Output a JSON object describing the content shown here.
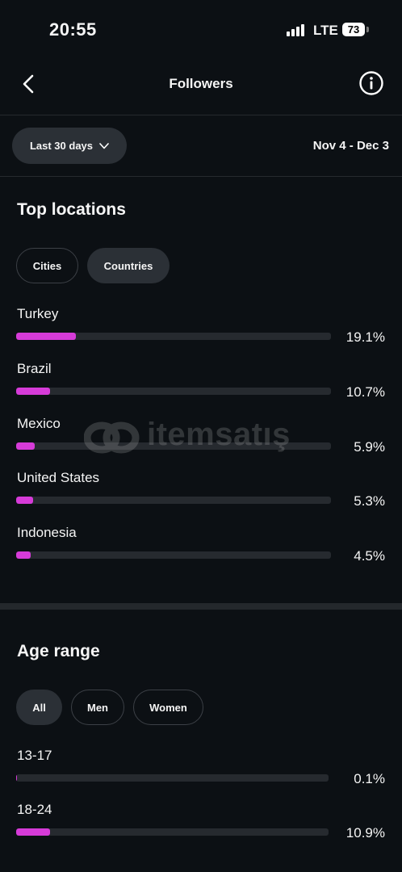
{
  "status_bar": {
    "time": "20:55",
    "network": "LTE",
    "battery": "73"
  },
  "nav": {
    "title": "Followers",
    "back_icon": "chevron-left-icon",
    "info_icon": "info-circle-icon"
  },
  "filter": {
    "range_label": "Last 30 days",
    "date_range": "Nov 4 - Dec 3"
  },
  "top_locations": {
    "title": "Top locations",
    "tabs": [
      {
        "label": "Cities",
        "selected": false
      },
      {
        "label": "Countries",
        "selected": true
      }
    ],
    "rows": [
      {
        "label": "Turkey",
        "percent": "19.1%",
        "value": 19.1
      },
      {
        "label": "Brazil",
        "percent": "10.7%",
        "value": 10.7
      },
      {
        "label": "Mexico",
        "percent": "5.9%",
        "value": 5.9
      },
      {
        "label": "United States",
        "percent": "5.3%",
        "value": 5.3
      },
      {
        "label": "Indonesia",
        "percent": "4.5%",
        "value": 4.5
      }
    ]
  },
  "age_range": {
    "title": "Age range",
    "tabs": [
      {
        "label": "All",
        "selected": true
      },
      {
        "label": "Men",
        "selected": false
      },
      {
        "label": "Women",
        "selected": false
      }
    ],
    "rows": [
      {
        "label": "13-17",
        "percent": "0.1%",
        "value": 0.1
      },
      {
        "label": "18-24",
        "percent": "10.9%",
        "value": 10.9
      }
    ]
  },
  "watermark": {
    "text": "itemsatış"
  },
  "colors": {
    "accent": "#d63bd8",
    "background": "#0c1014",
    "track": "#262a2f",
    "pill": "#2b3036"
  }
}
